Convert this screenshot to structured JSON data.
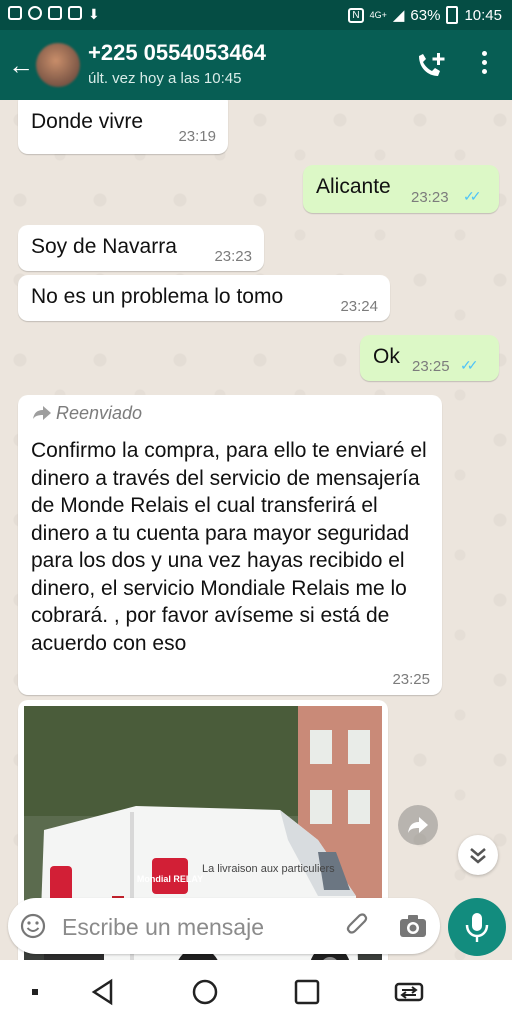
{
  "status_bar": {
    "battery": "63%",
    "time": "10:45",
    "network": "4G+"
  },
  "header": {
    "contact": "+225 0554053464",
    "last_seen": "últ. vez hoy a las 10:45",
    "icons": [
      "back-arrow-icon",
      "add-call-icon",
      "more-vert-icon"
    ]
  },
  "messages": [
    {
      "dir": "in",
      "text": "Donde vivre",
      "time": "23:19"
    },
    {
      "dir": "out",
      "text": "Alicante",
      "time": "23:23",
      "read": true
    },
    {
      "dir": "in",
      "text": "Soy de Navarra",
      "time": "23:23"
    },
    {
      "dir": "in",
      "text": "No es un problema lo tomo",
      "time": "23:24"
    },
    {
      "dir": "out",
      "text": "Ok",
      "time": "23:25",
      "read": true
    },
    {
      "dir": "in",
      "forwarded_label": "Reenviado",
      "text": "Confirmo la compra, para ello te enviaré el dinero a través del servicio de mensajería de Monde Relais el cual transferirá el dinero a tu cuenta para mayor seguridad para los dos y una vez hayas recibido el dinero, el servicio Mondiale Relais me lo cobrará. , por favor avíseme si está de acuerdo con eso",
      "time": "23:25"
    }
  ],
  "image_message": {
    "van_sign_logo": "Mondial RELAY",
    "van_sign_text": "La livraison aux particuliers"
  },
  "composer": {
    "placeholder": "Escribe un mensaje"
  },
  "colors": {
    "header": "#075e54",
    "status": "#054d44",
    "outgoing": "#dcf8c6",
    "incoming": "#ffffff",
    "background": "#ece5dd",
    "read_ticks": "#4fc3f7",
    "mic": "#128c7e"
  },
  "navigation_icons": [
    "square-icon",
    "back-triangle-icon",
    "home-circle-icon",
    "recents-square-icon",
    "switch-apps-icon"
  ]
}
